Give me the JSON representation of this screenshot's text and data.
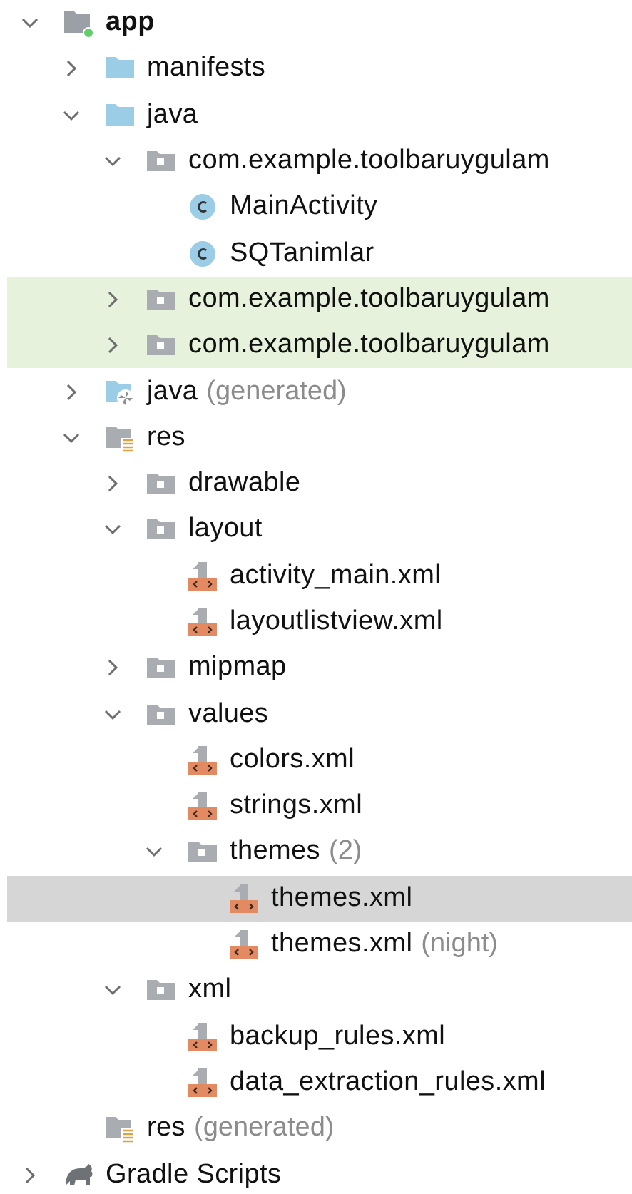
{
  "tree": [
    {
      "label": "app",
      "kind": "module",
      "expanded": true,
      "selected": false,
      "highlighted": false,
      "children": [
        {
          "label": "manifests",
          "kind": "folder",
          "expanded": false,
          "selected": false,
          "highlighted": false
        },
        {
          "label": "java",
          "kind": "folder",
          "expanded": true,
          "selected": false,
          "highlighted": false,
          "children": [
            {
              "label": "com.example.toolbaruygulam",
              "kind": "package",
              "expanded": true,
              "selected": false,
              "highlighted": false,
              "children": [
                {
                  "label": "MainActivity",
                  "kind": "class",
                  "selected": false,
                  "highlighted": false
                },
                {
                  "label": "SQTanimlar",
                  "kind": "class",
                  "selected": false,
                  "highlighted": false
                }
              ]
            },
            {
              "label": "com.example.toolbaruygulam",
              "kind": "package",
              "expanded": false,
              "selected": false,
              "highlighted": true
            },
            {
              "label": "com.example.toolbaruygulam",
              "kind": "package",
              "expanded": false,
              "selected": false,
              "highlighted": true
            }
          ]
        },
        {
          "label": "java",
          "note": "(generated)",
          "kind": "generated",
          "expanded": false,
          "selected": false,
          "highlighted": false
        },
        {
          "label": "res",
          "kind": "res",
          "expanded": true,
          "selected": false,
          "highlighted": false,
          "children": [
            {
              "label": "drawable",
              "kind": "package",
              "expanded": false,
              "selected": false,
              "highlighted": false
            },
            {
              "label": "layout",
              "kind": "package",
              "expanded": true,
              "selected": false,
              "highlighted": false,
              "children": [
                {
                  "label": "activity_main.xml",
                  "kind": "xml",
                  "selected": false,
                  "highlighted": false
                },
                {
                  "label": "layoutlistview.xml",
                  "kind": "xml",
                  "selected": false,
                  "highlighted": false
                }
              ]
            },
            {
              "label": "mipmap",
              "kind": "package",
              "expanded": false,
              "selected": false,
              "highlighted": false
            },
            {
              "label": "values",
              "kind": "package",
              "expanded": true,
              "selected": false,
              "highlighted": false,
              "children": [
                {
                  "label": "colors.xml",
                  "kind": "xml",
                  "selected": false,
                  "highlighted": false
                },
                {
                  "label": "strings.xml",
                  "kind": "xml",
                  "selected": false,
                  "highlighted": false
                },
                {
                  "label": "themes",
                  "note": "(2)",
                  "kind": "package",
                  "expanded": true,
                  "selected": false,
                  "highlighted": false,
                  "children": [
                    {
                      "label": "themes.xml",
                      "kind": "xml",
                      "selected": true,
                      "highlighted": false
                    },
                    {
                      "label": "themes.xml",
                      "note": "(night)",
                      "kind": "xml",
                      "selected": false,
                      "highlighted": false
                    }
                  ]
                }
              ]
            },
            {
              "label": "xml",
              "kind": "package",
              "expanded": true,
              "selected": false,
              "highlighted": false,
              "children": [
                {
                  "label": "backup_rules.xml",
                  "kind": "xml",
                  "selected": false,
                  "highlighted": false
                },
                {
                  "label": "data_extraction_rules.xml",
                  "kind": "xml",
                  "selected": false,
                  "highlighted": false
                }
              ]
            }
          ]
        },
        {
          "label": "res",
          "note": "(generated)",
          "kind": "res",
          "selected": false,
          "highlighted": false
        }
      ]
    },
    {
      "label": "Gradle Scripts",
      "kind": "gradle",
      "expanded": false,
      "selected": false,
      "highlighted": false
    }
  ]
}
